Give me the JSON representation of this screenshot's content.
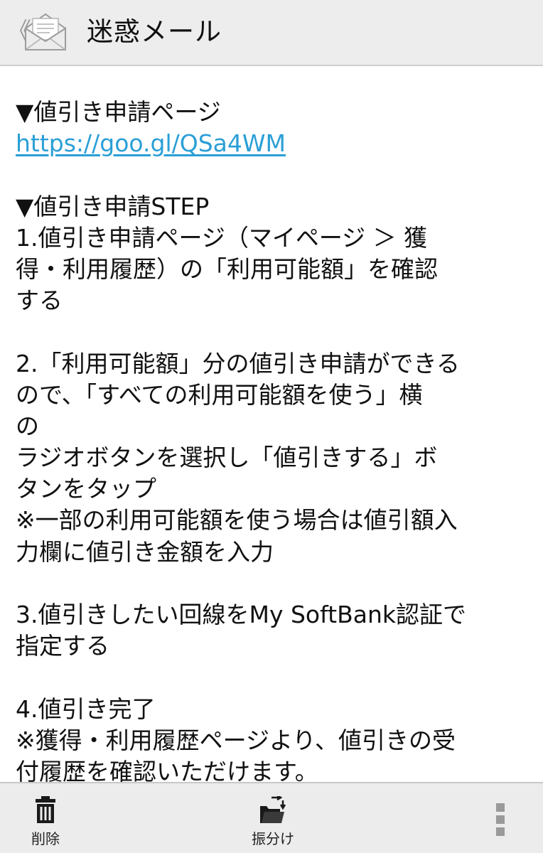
{
  "header": {
    "back_glyph": "《",
    "title": "迷惑メール",
    "icon": "mail-icon"
  },
  "body": {
    "lines": [
      {
        "text": "▼値引き申請ページ"
      },
      {
        "text": "https://goo.gl/QSa4WM",
        "link": true
      },
      {
        "text": ""
      },
      {
        "text": "▼値引き申請STEP"
      },
      {
        "text": "1.値引き申請ページ（マイページ ＞ 獲"
      },
      {
        "text": "得・利用履歴）の「利用可能額」を確認"
      },
      {
        "text": "する"
      },
      {
        "text": ""
      },
      {
        "text": "2.「利用可能額」分の値引き申請ができる"
      },
      {
        "text": "ので、「すべての利用可能額を使う」横"
      },
      {
        "text": "の"
      },
      {
        "text": "ラジオボタンを選択し「値引きする」ボ"
      },
      {
        "text": "タンをタップ"
      },
      {
        "text": "※一部の利用可能額を使う場合は値引額入"
      },
      {
        "text": "力欄に値引き金額を入力"
      },
      {
        "text": ""
      },
      {
        "text": "3.値引きしたい回線をMy SoftBank認証で"
      },
      {
        "text": "指定する"
      },
      {
        "text": ""
      },
      {
        "text": "4.値引き完了"
      },
      {
        "text": "※獲得・利用履歴ページより、値引きの受"
      },
      {
        "text": "付履歴を確認いただけます。"
      }
    ]
  },
  "footer": {
    "delete_label": "削除",
    "move_label": "振分け",
    "colors": {
      "bar": "#ececec",
      "icon": "#1a1a1a",
      "more": "#9a9a9a"
    }
  },
  "colors": {
    "header_bg": "#ededed",
    "link": "#2a9fd6",
    "text": "#111111"
  }
}
